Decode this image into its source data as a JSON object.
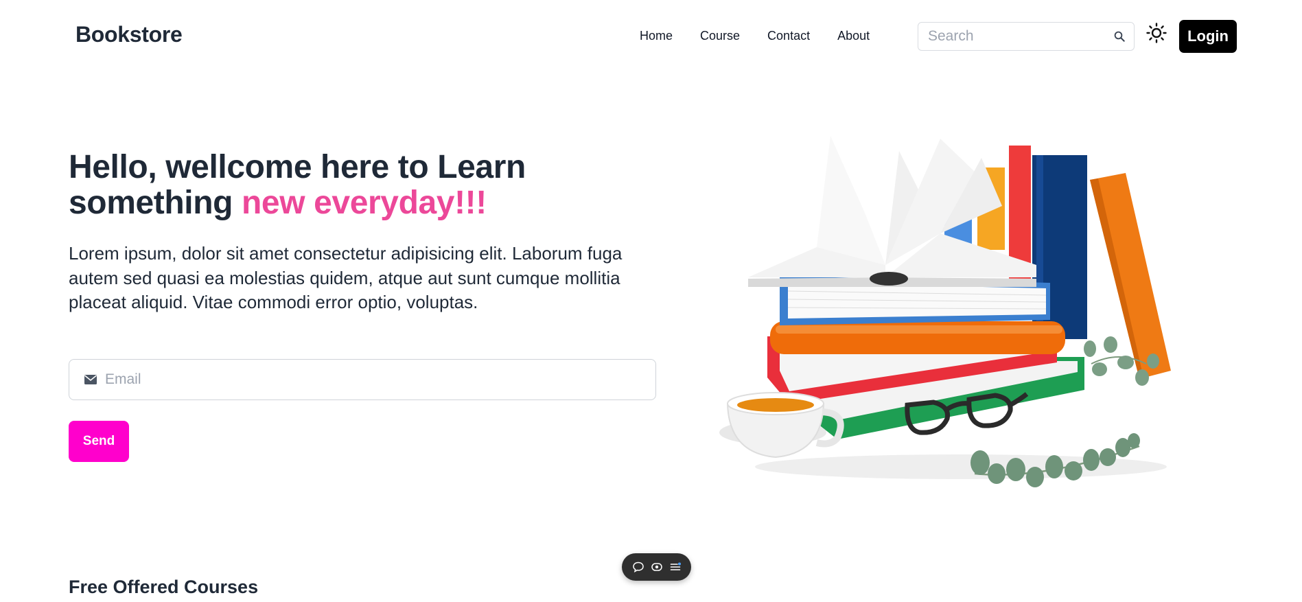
{
  "header": {
    "brand": "Bookstore",
    "nav": [
      "Home",
      "Course",
      "Contact",
      "About"
    ],
    "search_placeholder": "Search",
    "search_icon": "search-icon",
    "theme_icon": "sun-icon",
    "login_label": "Login"
  },
  "hero": {
    "title_part1": "Hello, wellcome here to Learn something ",
    "title_accent": "new everyday!!!",
    "body": "Lorem ipsum, dolor sit amet consectetur adipisicing elit. Laborum fuga autem sed quasi ea molestias quidem, atque aut sunt cumque mollitia placeat aliquid. Vitae commodi error optio, voluptas.",
    "email_placeholder": "Email",
    "email_icon": "mail-icon",
    "send_label": "Send"
  },
  "colors": {
    "accent": "#ec4899",
    "send_button": "#ff00cc",
    "login_button": "#000000"
  },
  "toolbar": {
    "icons": [
      "comment-icon",
      "eye-icon",
      "list-icon"
    ]
  },
  "courses": {
    "title": "Free Offered Courses"
  }
}
